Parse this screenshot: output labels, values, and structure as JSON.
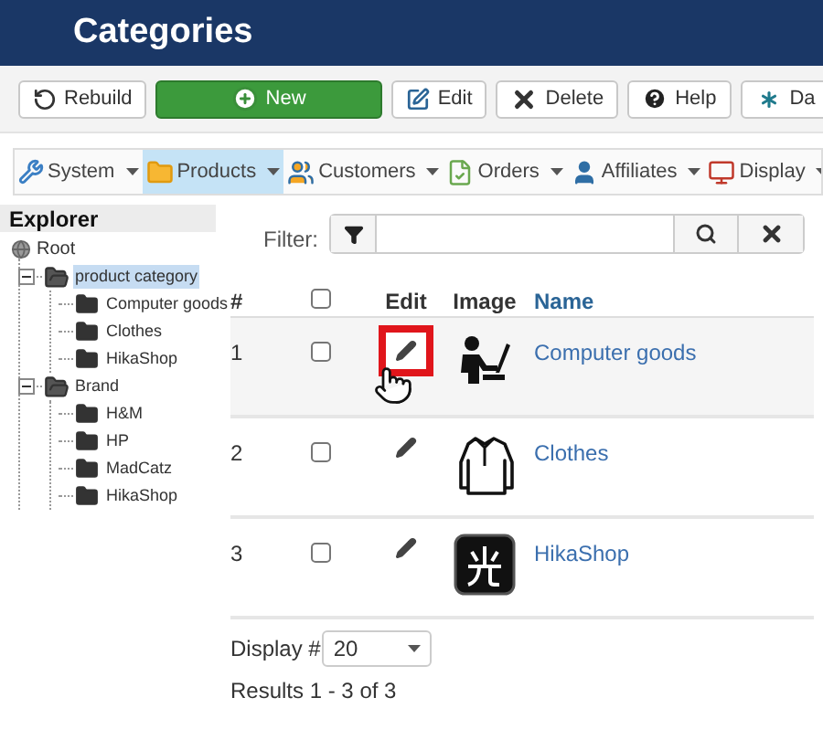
{
  "header": {
    "title": "Categories"
  },
  "toolbar": [
    {
      "label": "Rebuild",
      "kind": "rebuild"
    },
    {
      "label": "New",
      "kind": "new"
    },
    {
      "label": "Edit",
      "kind": "edit"
    },
    {
      "label": "Delete",
      "kind": "delete"
    },
    {
      "label": "Help",
      "kind": "help"
    },
    {
      "label": "Da",
      "kind": "dashboard"
    }
  ],
  "menu": [
    {
      "label": "System",
      "kind": "system",
      "selected": false
    },
    {
      "label": "Products",
      "kind": "products",
      "selected": true
    },
    {
      "label": "Customers",
      "kind": "customers",
      "selected": false
    },
    {
      "label": "Orders",
      "kind": "orders",
      "selected": false
    },
    {
      "label": "Affiliates",
      "kind": "affiliates",
      "selected": false
    },
    {
      "label": "Display",
      "kind": "display",
      "selected": false
    }
  ],
  "explorer": {
    "title": "Explorer",
    "root": "Root",
    "children": [
      {
        "label": "product category",
        "selected": true,
        "expanded": true,
        "children": [
          {
            "label": "Computer goods",
            "selected": false
          },
          {
            "label": "Clothes",
            "selected": false
          },
          {
            "label": "HikaShop",
            "selected": false
          }
        ]
      },
      {
        "label": "Brand",
        "selected": false,
        "expanded": true,
        "children": [
          {
            "label": "H&M",
            "selected": false
          },
          {
            "label": "HP",
            "selected": false
          },
          {
            "label": "MadCatz",
            "selected": false
          },
          {
            "label": "HikaShop",
            "selected": false
          }
        ]
      }
    ]
  },
  "filter": {
    "label": "Filter:"
  },
  "table": {
    "columns": [
      "#",
      "Edit",
      "Image",
      "Name"
    ],
    "all_checked": false,
    "rows": [
      {
        "number": "1",
        "checked": false,
        "kind": "computer",
        "name": "Computer goods",
        "hovered": true
      },
      {
        "number": "2",
        "checked": false,
        "kind": "clothes",
        "name": "Clothes",
        "hovered": false
      },
      {
        "number": "3",
        "checked": false,
        "kind": "logo",
        "name": "HikaShop",
        "hovered": false
      }
    ]
  },
  "pagination": {
    "label": "Display #",
    "value": "20",
    "results": "Results 1 - 3 of 3"
  }
}
